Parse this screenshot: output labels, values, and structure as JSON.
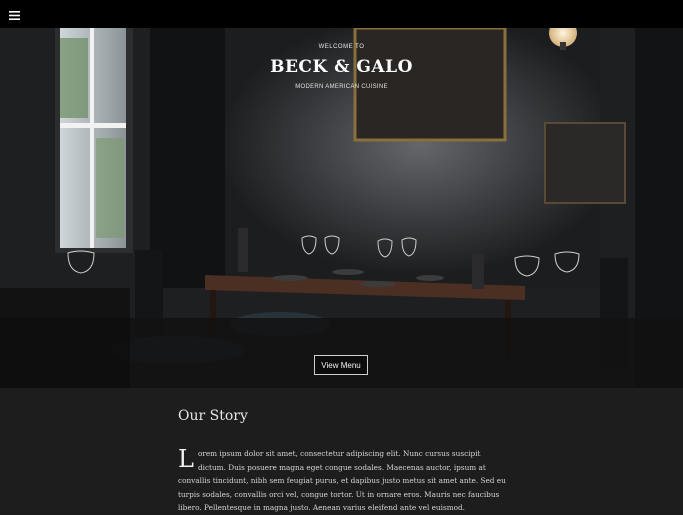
{
  "nav": {
    "menu_icon": "hamburger-icon"
  },
  "hero": {
    "welcome": "WELCOME TO",
    "brand": "BECK & GALO",
    "tagline": "MODERN AMERICAN CUISINE",
    "cta_label": "View Menu"
  },
  "story": {
    "title": "Our Story",
    "dropcap": "L",
    "body": "orem ipsum dolor sit amet, consectetur adipiscing elit. Nunc cursus suscipit dictum. Duis posuere magna eget congue sodales. Maecenas auctor, ipsum at convallis tincidunt, nibh sem feugiat purus, et dapibus justo metus sit amet ante. Sed eu turpis sodales, convallis orci vel, congue tortor. Ut in ornare eros. Mauris nec faucibus libero. Pellentesque in magna justo. Aenean varius eleifend ante vel euismod."
  }
}
